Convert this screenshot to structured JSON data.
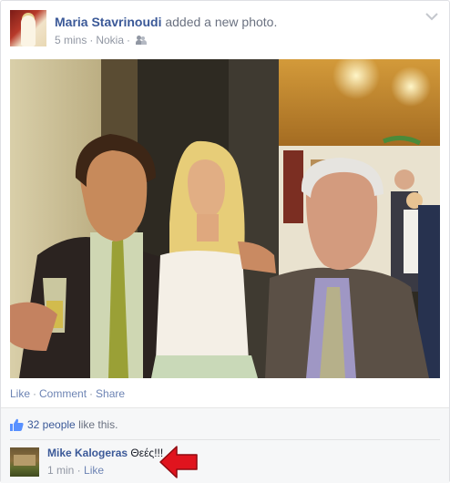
{
  "post": {
    "author": "Maria Stavrinoudi",
    "action": "added a new photo.",
    "time": "5 mins",
    "via": "Nokia",
    "audience_icon": "friends-icon",
    "menu_icon": "chevron-down-icon"
  },
  "actions": {
    "like": "Like",
    "comment": "Comment",
    "share": "Share"
  },
  "likes": {
    "icon": "thumbs-up-icon",
    "count_text": "32 people",
    "suffix": "like this."
  },
  "comment": {
    "author": "Mike Kalogeras",
    "text": "Θεές!!!",
    "time": "1 min",
    "like": "Like"
  },
  "annotation": {
    "icon": "red-arrow-icon",
    "color": "#e0141e"
  },
  "colors": {
    "link": "#3b5998",
    "secondary_link": "#6d84b4",
    "meta": "#9197a3",
    "ufi_background": "#f6f7f8"
  }
}
